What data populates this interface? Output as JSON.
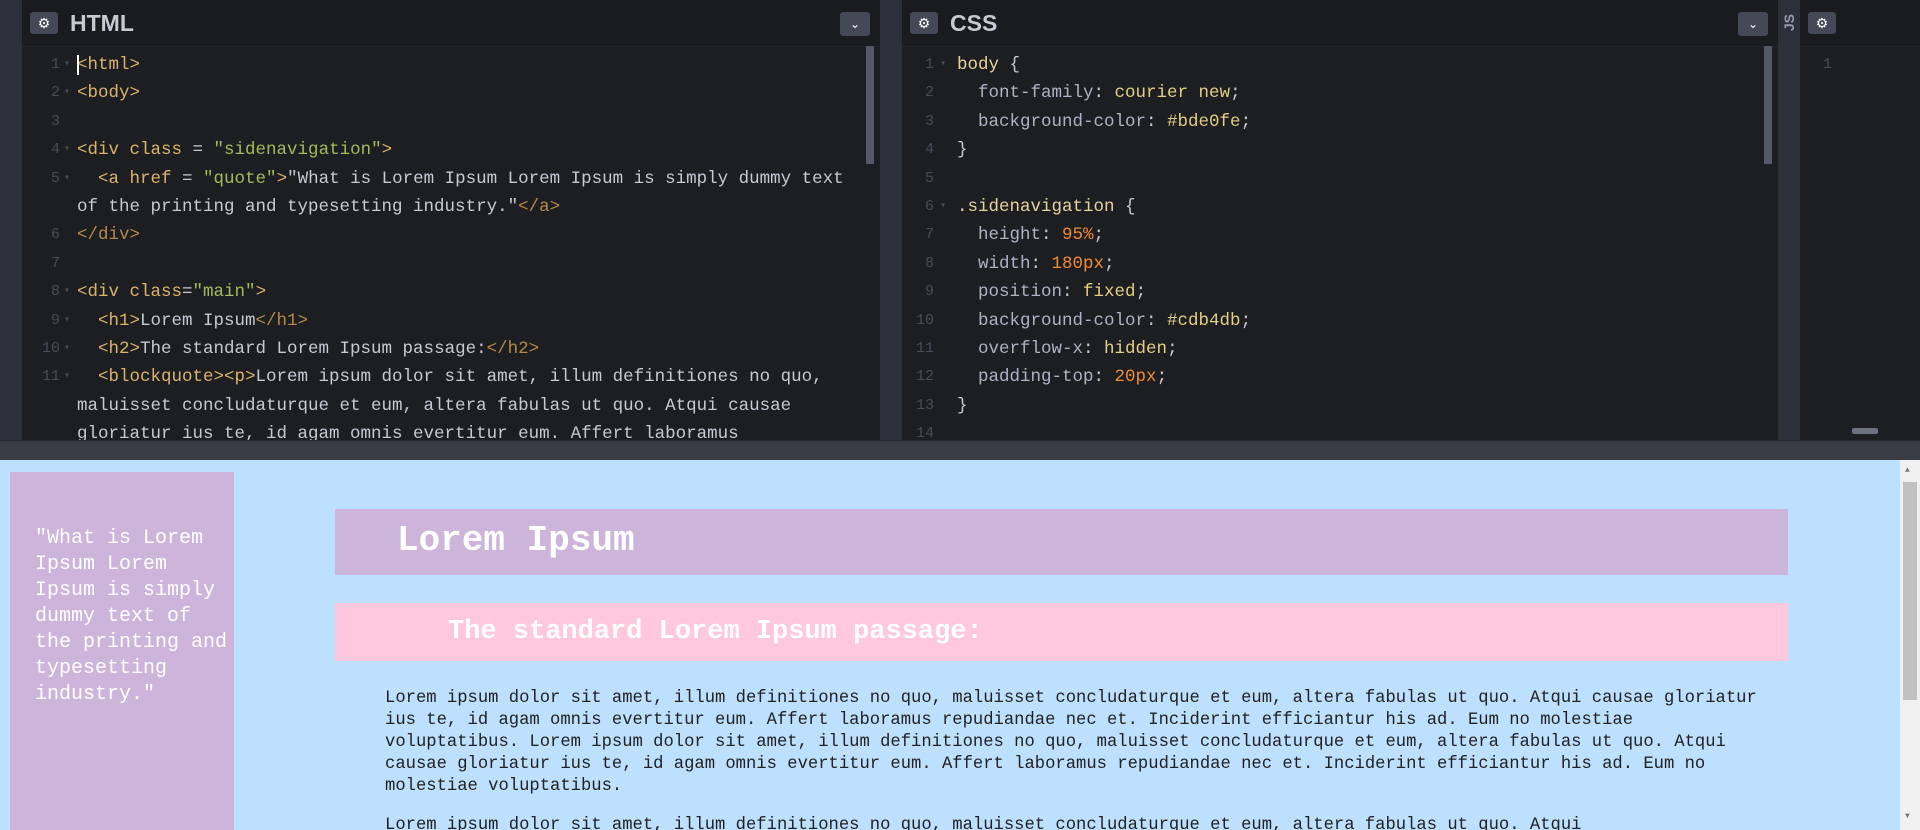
{
  "editors": {
    "html": {
      "title": "HTML",
      "gear": "⚙",
      "chevron": "⌄",
      "lines": [
        {
          "n": "1",
          "fold": "▾",
          "segs": [
            [
              "t-tag",
              "<html>"
            ]
          ]
        },
        {
          "n": "2",
          "fold": "▾",
          "segs": [
            [
              "t-tag",
              "<body>"
            ]
          ]
        },
        {
          "n": "3",
          "fold": "",
          "segs": []
        },
        {
          "n": "4",
          "fold": "▾",
          "segs": [
            [
              "t-tag",
              "<div "
            ],
            [
              "t-attr",
              "class"
            ],
            [
              "t-punct",
              " = "
            ],
            [
              "t-str",
              "\"sidenavigation\""
            ],
            [
              "t-tag",
              ">"
            ]
          ]
        },
        {
          "n": "5",
          "fold": "▾",
          "segs": [
            [
              "t-tag",
              "  <a "
            ],
            [
              "t-attr",
              "href"
            ],
            [
              "t-punct",
              " = "
            ],
            [
              "t-str",
              "\"quote\""
            ],
            [
              "t-tag",
              ">"
            ],
            [
              "t-punct",
              "\"What is Lorem Ipsum Lorem Ipsum is simply dummy text"
            ]
          ]
        },
        {
          "n": "",
          "fold": "",
          "segs": [
            [
              "t-punct",
              "of the printing and typesetting industry.\""
            ],
            [
              "t-tagend",
              "</a>"
            ]
          ]
        },
        {
          "n": "6",
          "fold": "",
          "segs": [
            [
              "t-tagend",
              "</div>"
            ]
          ]
        },
        {
          "n": "7",
          "fold": "",
          "segs": []
        },
        {
          "n": "8",
          "fold": "▾",
          "segs": [
            [
              "t-tag",
              "<div "
            ],
            [
              "t-attr",
              "class"
            ],
            [
              "t-punct",
              "="
            ],
            [
              "t-str",
              "\"main\""
            ],
            [
              "t-tag",
              ">"
            ]
          ]
        },
        {
          "n": "9",
          "fold": "▾",
          "segs": [
            [
              "t-tag",
              "  <h1>"
            ],
            [
              "t-punct",
              "Lorem Ipsum"
            ],
            [
              "t-tagend",
              "</h1>"
            ]
          ]
        },
        {
          "n": "10",
          "fold": "▾",
          "segs": [
            [
              "t-tag",
              "  <h2>"
            ],
            [
              "t-punct",
              "The standard Lorem Ipsum passage:"
            ],
            [
              "t-tagend",
              "</h2>"
            ]
          ]
        },
        {
          "n": "11",
          "fold": "▾",
          "segs": [
            [
              "t-tag",
              "  <blockquote><p>"
            ],
            [
              "t-punct",
              "Lorem ipsum dolor sit amet, illum definitiones no quo,"
            ]
          ]
        },
        {
          "n": "",
          "fold": "",
          "segs": [
            [
              "t-punct",
              "maluisset concludaturque et eum, altera fabulas ut quo. Atqui causae"
            ]
          ]
        },
        {
          "n": "",
          "fold": "",
          "segs": [
            [
              "t-punct",
              "gloriatur ius te, id agam omnis evertitur eum. Affert laboramus"
            ]
          ]
        }
      ]
    },
    "css": {
      "title": "CSS",
      "gear": "⚙",
      "chevron": "⌄",
      "lines": [
        {
          "n": "1",
          "fold": "▾",
          "segs": [
            [
              "t-sel",
              "body"
            ],
            [
              "t-punct",
              " {"
            ]
          ]
        },
        {
          "n": "2",
          "fold": "",
          "segs": [
            [
              "t-prop",
              "  font-family"
            ],
            [
              "t-punct",
              ": "
            ],
            [
              "t-val",
              "courier new"
            ],
            [
              "t-punct",
              ";"
            ]
          ]
        },
        {
          "n": "3",
          "fold": "",
          "segs": [
            [
              "t-prop",
              "  background-color"
            ],
            [
              "t-punct",
              ": "
            ],
            [
              "t-hex",
              "#bde0fe"
            ],
            [
              "t-punct",
              ";"
            ]
          ]
        },
        {
          "n": "4",
          "fold": "",
          "segs": [
            [
              "t-punct",
              "}"
            ]
          ]
        },
        {
          "n": "5",
          "fold": "",
          "segs": []
        },
        {
          "n": "6",
          "fold": "▾",
          "segs": [
            [
              "t-sel",
              ".sidenavigation"
            ],
            [
              "t-punct",
              " {"
            ]
          ]
        },
        {
          "n": "7",
          "fold": "",
          "segs": [
            [
              "t-prop",
              "  height"
            ],
            [
              "t-punct",
              ": "
            ],
            [
              "t-num",
              "95%"
            ],
            [
              "t-punct",
              ";"
            ]
          ]
        },
        {
          "n": "8",
          "fold": "",
          "segs": [
            [
              "t-prop",
              "  width"
            ],
            [
              "t-punct",
              ": "
            ],
            [
              "t-num",
              "180px"
            ],
            [
              "t-punct",
              ";"
            ]
          ]
        },
        {
          "n": "9",
          "fold": "",
          "segs": [
            [
              "t-prop",
              "  position"
            ],
            [
              "t-punct",
              ": "
            ],
            [
              "t-val",
              "fixed"
            ],
            [
              "t-punct",
              ";"
            ]
          ]
        },
        {
          "n": "10",
          "fold": "",
          "segs": [
            [
              "t-prop",
              "  background-color"
            ],
            [
              "t-punct",
              ": "
            ],
            [
              "t-hex",
              "#cdb4db"
            ],
            [
              "t-punct",
              ";"
            ]
          ]
        },
        {
          "n": "11",
          "fold": "",
          "segs": [
            [
              "t-prop",
              "  overflow-x"
            ],
            [
              "t-punct",
              ": "
            ],
            [
              "t-val",
              "hidden"
            ],
            [
              "t-punct",
              ";"
            ]
          ]
        },
        {
          "n": "12",
          "fold": "",
          "segs": [
            [
              "t-prop",
              "  padding-top"
            ],
            [
              "t-punct",
              ": "
            ],
            [
              "t-num",
              "20px"
            ],
            [
              "t-punct",
              ";"
            ]
          ]
        },
        {
          "n": "13",
          "fold": "",
          "segs": [
            [
              "t-punct",
              "}"
            ]
          ]
        },
        {
          "n": "14",
          "fold": "",
          "segs": []
        }
      ]
    },
    "js": {
      "title": "JS",
      "gear": "⚙",
      "line_number": "1"
    }
  },
  "preview": {
    "sidenav_link": "\"What is Lorem Ipsum Lorem Ipsum is simply dummy text of the printing and typesetting industry.\"",
    "h1": "Lorem Ipsum",
    "h2": "The standard Lorem Ipsum passage:",
    "paragraph1": "Lorem ipsum dolor sit amet, illum definitiones no quo, maluisset concludaturque et eum, altera fabulas ut quo. Atqui causae gloriatur ius te, id agam omnis evertitur eum. Affert laboramus repudiandae nec et. Inciderint efficiantur his ad. Eum no molestiae voluptatibus. Lorem ipsum dolor sit amet, illum definitiones no quo, maluisset concludaturque et eum, altera fabulas ut quo. Atqui causae gloriatur ius te, id agam omnis evertitur eum. Affert laboramus repudiandae nec et. Inciderint efficiantur his ad. Eum no molestiae voluptatibus.",
    "paragraph2": "Lorem ipsum dolor sit amet, illum definitiones no quo, maluisset concludaturque et eum, altera fabulas ut quo. Atqui",
    "colors": {
      "background": "#bde0fe",
      "sidenav": "#cdb4db",
      "h2_bg": "#ffc8dd"
    }
  }
}
